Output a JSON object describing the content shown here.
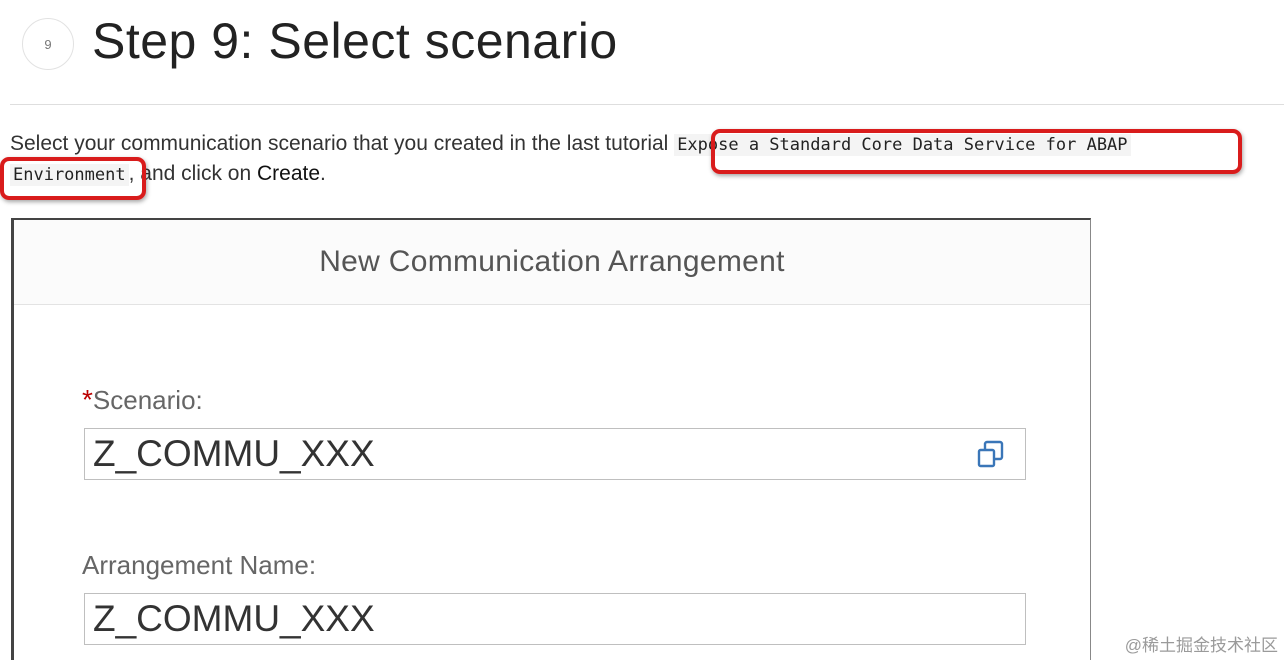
{
  "step": {
    "number": "9",
    "title": "Step 9: Select scenario"
  },
  "instructions": {
    "before_code": "Select your communication scenario that you created in the last tutorial ",
    "code_line1": "Expose a Standard Core Data Service for ABAP",
    "code_line2": "Environment",
    "between": ", and click on ",
    "action": "Create",
    "end": "."
  },
  "dialog": {
    "title": "New Communication Arrangement",
    "scenario": {
      "required_marker": "*",
      "label": "Scenario:",
      "value": "Z_COMMU_XXX",
      "value_help_icon": "value-help-icon"
    },
    "arrangement": {
      "label": "Arrangement Name:",
      "value": "Z_COMMU_XXX"
    }
  },
  "watermark": "@稀土掘金技术社区",
  "colors": {
    "highlight": "#d91c1c",
    "required": "#bb0000",
    "icon": "#3a76b8"
  }
}
